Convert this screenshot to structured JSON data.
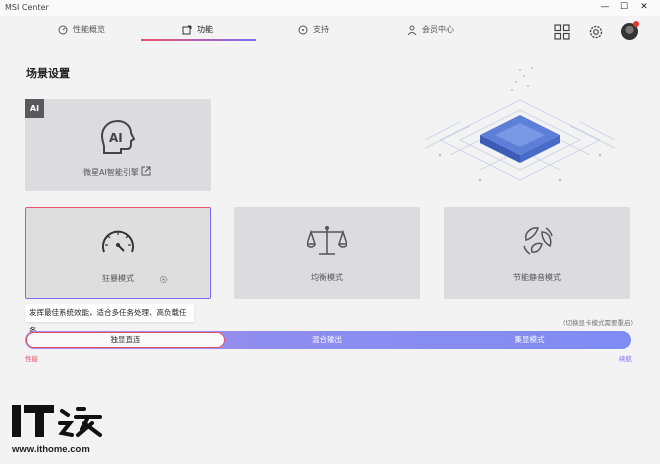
{
  "window": {
    "title": "MSI Center",
    "minimize": "—",
    "maximize": "☐",
    "close": "✕"
  },
  "nav": {
    "tabs": [
      {
        "label": "性能概览",
        "icon": "gauge-icon"
      },
      {
        "label": "功能",
        "icon": "function-icon",
        "active": true
      },
      {
        "label": "支持",
        "icon": "support-icon"
      },
      {
        "label": "会员中心",
        "icon": "user-icon"
      }
    ],
    "right_icons": [
      "grid-icon",
      "settings-icon",
      "avatar"
    ]
  },
  "section": {
    "title": "场景设置"
  },
  "ai_card": {
    "badge": "AI",
    "label": "微星AI智能引擎",
    "icon": "ai-head-icon",
    "link_icon": "external-link-icon"
  },
  "modes": [
    {
      "label": "狂暴模式",
      "icon": "speedometer-icon",
      "active": true,
      "settings_icon": "gear-icon"
    },
    {
      "label": "均衡模式",
      "icon": "balance-scale-icon",
      "active": false
    },
    {
      "label": "节能静音模式",
      "icon": "leaf-cycle-icon",
      "active": false
    }
  ],
  "tooltip": "发挥最佳系统效能，适合多任务处理、高负载任务。",
  "gpu_note": "(切换显卡模式需要重启)",
  "gpu_switch": {
    "options": [
      "独显直连",
      "混合输出",
      "集显模式"
    ],
    "selected": "独显直连",
    "left_label": "性能",
    "right_label": "续航"
  },
  "colors": {
    "accent_red": "#e9506a",
    "accent_purple": "#7a6df2",
    "card_bg": "#dcdcde",
    "page_bg": "#f3f3f4"
  },
  "watermark": {
    "logo_text": "IT之家",
    "url": "www.ithome.com"
  }
}
